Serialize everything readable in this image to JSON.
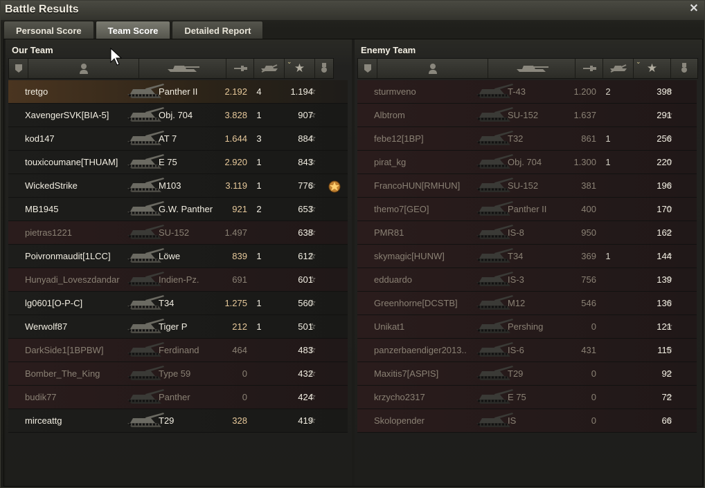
{
  "window": {
    "title": "Battle Results",
    "close_icon": "close-icon"
  },
  "tabs": [
    {
      "label": "Personal Score",
      "active": false
    },
    {
      "label": "Team Score",
      "active": true
    },
    {
      "label": "Detailed Report",
      "active": false
    }
  ],
  "our_team": {
    "title": "Our Team",
    "rows": [
      {
        "name": "tretgo",
        "vehicle": "Panther II",
        "damage": "2.192",
        "kills": "4",
        "xp": "1.194",
        "medal": false,
        "highlight": true,
        "dim": false
      },
      {
        "name": "XavengerSVK[BIA-5]",
        "vehicle": "Obj. 704",
        "damage": "3.828",
        "kills": "1",
        "xp": "907",
        "medal": false,
        "highlight": false,
        "dim": false
      },
      {
        "name": "kod147",
        "vehicle": "AT 7",
        "damage": "1.644",
        "kills": "3",
        "xp": "884",
        "medal": false,
        "highlight": false,
        "dim": false
      },
      {
        "name": "touxicoumane[THUAM]",
        "vehicle": "E 75",
        "damage": "2.920",
        "kills": "1",
        "xp": "843",
        "medal": false,
        "highlight": false,
        "dim": false
      },
      {
        "name": "WickedStrike",
        "vehicle": "M103",
        "damage": "3.119",
        "kills": "1",
        "xp": "776",
        "medal": true,
        "highlight": false,
        "dim": false
      },
      {
        "name": "MB1945",
        "vehicle": "G.W. Panther",
        "damage": "921",
        "kills": "2",
        "xp": "653",
        "medal": false,
        "highlight": false,
        "dim": false
      },
      {
        "name": "pietras1221",
        "vehicle": "SU-152",
        "damage": "1.497",
        "kills": "",
        "xp": "638",
        "medal": false,
        "highlight": false,
        "dim": true
      },
      {
        "name": "Poivronmaudit[1LCC]",
        "vehicle": "Löwe",
        "damage": "839",
        "kills": "1",
        "xp": "612",
        "medal": false,
        "highlight": false,
        "dim": false
      },
      {
        "name": "Hunyadi_Loveszdandar",
        "vehicle": "Indien-Pz.",
        "damage": "691",
        "kills": "",
        "xp": "601",
        "medal": false,
        "highlight": false,
        "dim": true
      },
      {
        "name": "lg0601[O-P-C]",
        "vehicle": "T34",
        "damage": "1.275",
        "kills": "1",
        "xp": "560",
        "medal": false,
        "highlight": false,
        "dim": false
      },
      {
        "name": "Werwolf87",
        "vehicle": "Tiger P",
        "damage": "212",
        "kills": "1",
        "xp": "501",
        "medal": false,
        "highlight": false,
        "dim": false
      },
      {
        "name": "DarkSide1[1BPBW]",
        "vehicle": "Ferdinand",
        "damage": "464",
        "kills": "",
        "xp": "483",
        "medal": false,
        "highlight": false,
        "dim": true
      },
      {
        "name": "Bomber_The_King",
        "vehicle": "Type 59",
        "damage": "0",
        "kills": "",
        "xp": "432",
        "medal": false,
        "highlight": false,
        "dim": true
      },
      {
        "name": "budik77",
        "vehicle": "Panther",
        "damage": "0",
        "kills": "",
        "xp": "424",
        "medal": false,
        "highlight": false,
        "dim": true
      },
      {
        "name": "mirceattg",
        "vehicle": "T29",
        "damage": "328",
        "kills": "",
        "xp": "419",
        "medal": false,
        "highlight": false,
        "dim": false
      }
    ]
  },
  "enemy_team": {
    "title": "Enemy Team",
    "rows": [
      {
        "name": "sturmveno",
        "vehicle": "T-43",
        "damage": "1.200",
        "kills": "2",
        "xp": "398"
      },
      {
        "name": "Albtrom",
        "vehicle": "SU-152",
        "damage": "1.637",
        "kills": "",
        "xp": "291"
      },
      {
        "name": "febe12[1BP]",
        "vehicle": "T32",
        "damage": "861",
        "kills": "1",
        "xp": "256"
      },
      {
        "name": "pirat_kg",
        "vehicle": "Obj. 704",
        "damage": "1.300",
        "kills": "1",
        "xp": "220"
      },
      {
        "name": "FrancoHUN[RMHUN]",
        "vehicle": "SU-152",
        "damage": "381",
        "kills": "",
        "xp": "196"
      },
      {
        "name": "themo7[GEO]",
        "vehicle": "Panther II",
        "damage": "400",
        "kills": "",
        "xp": "170"
      },
      {
        "name": "PMR81",
        "vehicle": "IS-8",
        "damage": "950",
        "kills": "",
        "xp": "162"
      },
      {
        "name": "skymagic[HUNW]",
        "vehicle": "T34",
        "damage": "369",
        "kills": "1",
        "xp": "144"
      },
      {
        "name": "edduardo",
        "vehicle": "IS-3",
        "damage": "756",
        "kills": "",
        "xp": "139"
      },
      {
        "name": "Greenhorne[DCSTB]",
        "vehicle": "M12",
        "damage": "546",
        "kills": "",
        "xp": "136"
      },
      {
        "name": "Unikat1",
        "vehicle": "Pershing",
        "damage": "0",
        "kills": "",
        "xp": "121"
      },
      {
        "name": "panzerbaendiger2013..",
        "vehicle": "IS-6",
        "damage": "431",
        "kills": "",
        "xp": "115"
      },
      {
        "name": "Maxitis7[ASPIS]",
        "vehicle": "T29",
        "damage": "0",
        "kills": "",
        "xp": "92"
      },
      {
        "name": "krzycho2317",
        "vehicle": "E 75",
        "damage": "0",
        "kills": "",
        "xp": "72"
      },
      {
        "name": "Skolopender",
        "vehicle": "IS",
        "damage": "0",
        "kills": "",
        "xp": "66"
      }
    ]
  },
  "column_icons": [
    "platoon-icon",
    "player-icon",
    "tank-icon",
    "damage-icon",
    "kills-icon",
    "xp-star-icon",
    "medal-icon"
  ],
  "colors": {
    "highlight_row": "#4a3520",
    "damage_text": "#e6c89a",
    "dim_text": "#8a8174"
  }
}
